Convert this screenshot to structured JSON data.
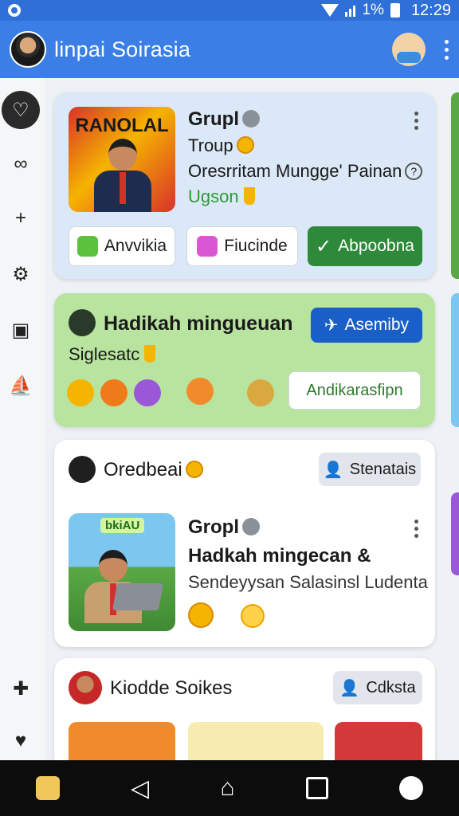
{
  "status_bar": {
    "battery": "1%",
    "time": "12:29"
  },
  "app_bar": {
    "title": "linpai Soirasia",
    "avatar_icon": "profile-avatar",
    "mascot_icon": "mascot-icon"
  },
  "rail": {
    "items": [
      "heart-icon",
      "infinity-icon",
      "plus-icon",
      "gear-icon",
      "book-icon",
      "boat-icon",
      "cross-icon",
      "heart-filled-icon"
    ]
  },
  "card1": {
    "thumb_title": "RANOLAL",
    "title": "Grupl",
    "line1": "Troup",
    "line2": "Oresrritam Mungge' Painan",
    "line3": "Ugson",
    "buttons": [
      "Anvvikia",
      "Fiucinde",
      "Abpoobna"
    ]
  },
  "card2": {
    "title": "Hadikah mingueuan",
    "subtitle": "Siglesatc",
    "action": "Asemiby",
    "secondary": "Andikarasfipn"
  },
  "card3": {
    "title": "Oredbeai",
    "chip": "Stenatais",
    "thumb_badge": "bkiAU",
    "name": "Gropl",
    "heading": "Hadkah mingecan &",
    "sub": "Sendeyysan Salasinsl Ludenta"
  },
  "card4": {
    "title": "Kiodde Soikes",
    "chip": "Cdksta"
  },
  "colors": {
    "primary": "#3a7ee6",
    "green_card": "#b8e49f",
    "blue_card": "#dbe8f7",
    "accent_green": "#2e8a3a",
    "accent_blue": "#1a5fc8"
  }
}
